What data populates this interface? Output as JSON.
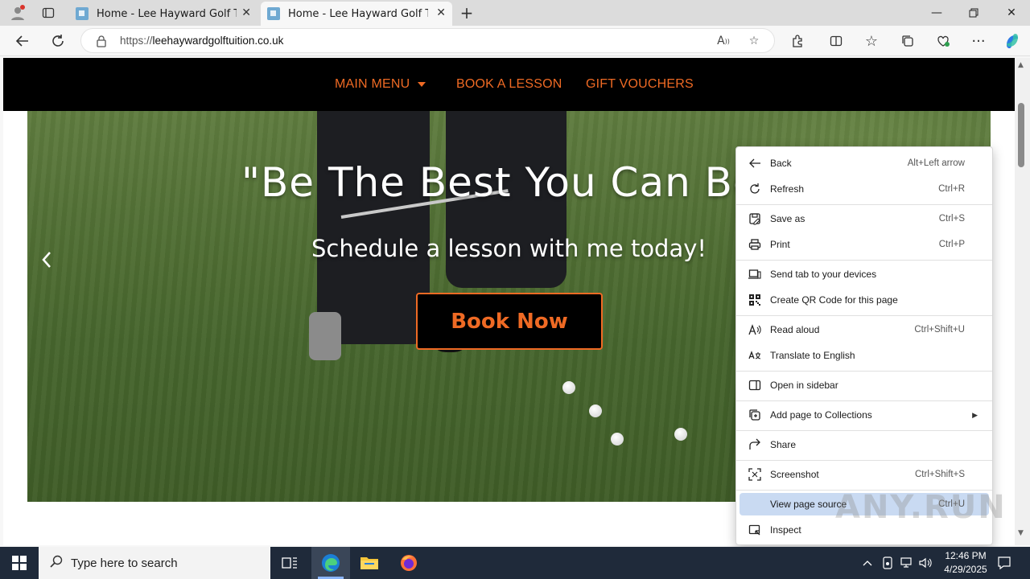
{
  "browser": {
    "tabs": [
      {
        "title": "Home - Lee Hayward Golf Tuition",
        "active": false
      },
      {
        "title": "Home - Lee Hayward Golf Tuition",
        "active": true
      }
    ],
    "url_prefix": "https://",
    "url_domain": "leehaywardgolftuition.co.uk"
  },
  "site": {
    "nav": [
      "MAIN MENU",
      "BOOK A LESSON",
      "GIFT VOUCHERS"
    ],
    "hero_title": "\"Be The Best You Can Be\"",
    "hero_subtitle": "Schedule a lesson with me today!",
    "cta_label": "Book Now",
    "accent_color": "#ef6a24"
  },
  "context_menu": {
    "items": [
      {
        "label": "Back",
        "shortcut": "Alt+Left arrow",
        "icon": "back-arrow-icon"
      },
      {
        "label": "Refresh",
        "shortcut": "Ctrl+R",
        "icon": "refresh-icon"
      },
      {
        "label": "Save as",
        "shortcut": "Ctrl+S",
        "icon": "save-icon"
      },
      {
        "label": "Print",
        "shortcut": "Ctrl+P",
        "icon": "print-icon"
      },
      {
        "label": "Send tab to your devices",
        "shortcut": "",
        "icon": "devices-icon"
      },
      {
        "label": "Create QR Code for this page",
        "shortcut": "",
        "icon": "qr-code-icon"
      },
      {
        "label": "Read aloud",
        "shortcut": "Ctrl+Shift+U",
        "icon": "read-aloud-icon"
      },
      {
        "label": "Translate to English",
        "shortcut": "",
        "icon": "translate-icon"
      },
      {
        "label": "Open in sidebar",
        "shortcut": "",
        "icon": "sidebar-icon"
      },
      {
        "label": "Add page to Collections",
        "shortcut": "",
        "icon": "collections-icon"
      },
      {
        "label": "Share",
        "shortcut": "",
        "icon": "share-icon"
      },
      {
        "label": "Screenshot",
        "shortcut": "Ctrl+Shift+S",
        "icon": "screenshot-icon"
      },
      {
        "label": "View page source",
        "shortcut": "Ctrl+U",
        "icon": "",
        "highlighted": true
      },
      {
        "label": "Inspect",
        "shortcut": "",
        "icon": "inspect-icon"
      }
    ]
  },
  "watermark": "ANY.RUN",
  "taskbar": {
    "search_placeholder": "Type here to search",
    "time": "12:46 PM",
    "date": "4/29/2025"
  }
}
